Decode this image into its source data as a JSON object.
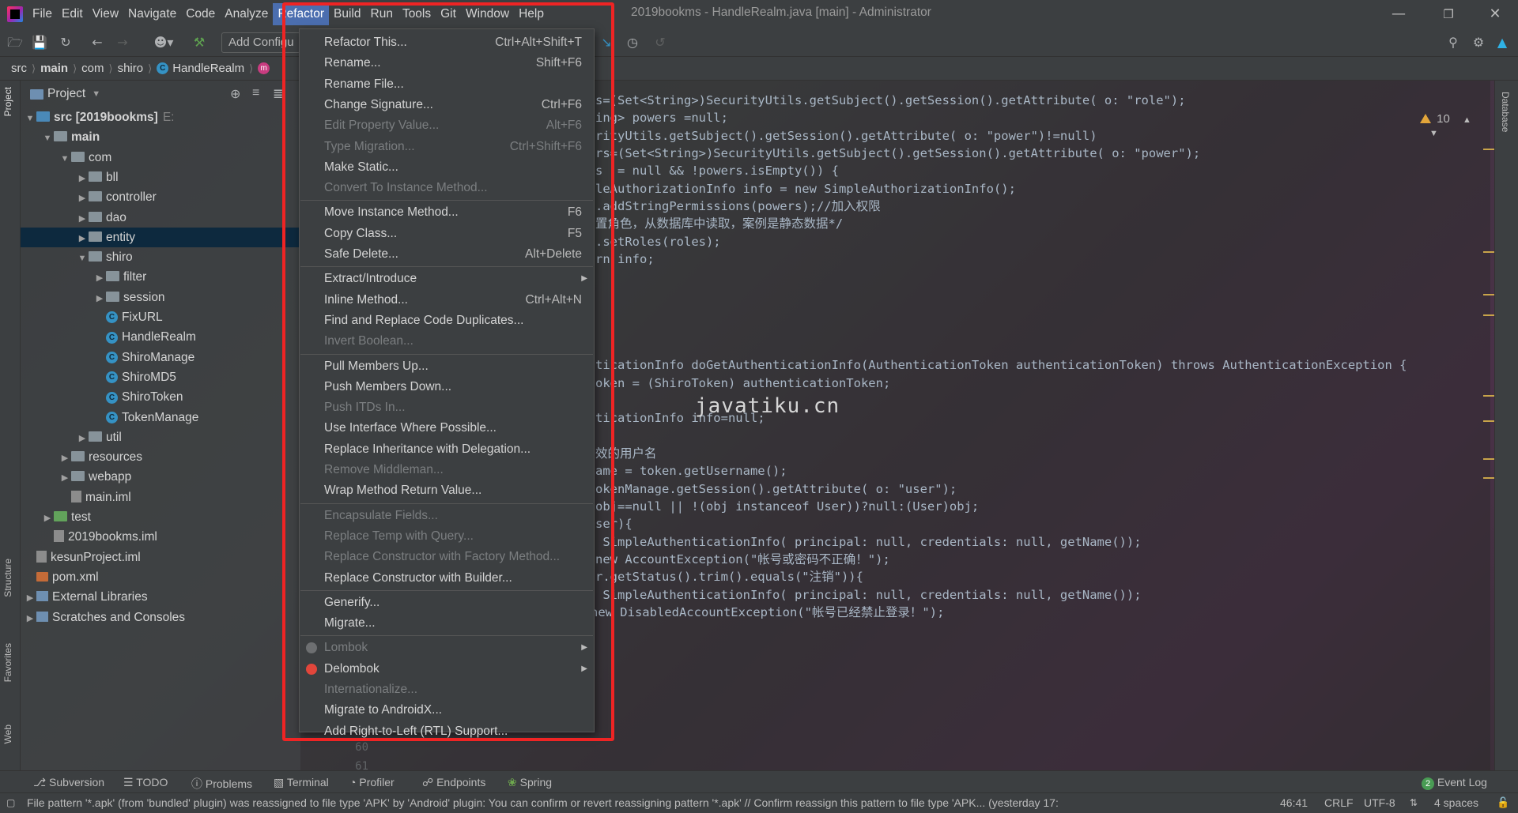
{
  "menubar": {
    "items": [
      "File",
      "Edit",
      "View",
      "Navigate",
      "Code",
      "Analyze",
      "Refactor",
      "Build",
      "Run",
      "Tools",
      "Git",
      "Window",
      "Help"
    ],
    "active": "Refactor"
  },
  "window_title": "2019bookms - HandleRealm.java [main] - Administrator",
  "toolbar": {
    "add_configuration": "Add Configu"
  },
  "breadcrumb": [
    "src",
    "main",
    "com",
    "shiro",
    "HandleRealm"
  ],
  "left_strip": {
    "project": "Project",
    "structure": "Structure",
    "favorites": "Favorites",
    "web": "Web"
  },
  "right_strip": {
    "database": "Database"
  },
  "project": {
    "title": "Project",
    "tree": [
      {
        "label": "src [2019bookms]",
        "suffix": "E:",
        "type": "module"
      },
      {
        "label": "main",
        "type": "folder"
      },
      {
        "label": "com",
        "type": "folder"
      },
      {
        "label": "bll",
        "type": "package"
      },
      {
        "label": "controller",
        "type": "package"
      },
      {
        "label": "dao",
        "type": "package"
      },
      {
        "label": "entity",
        "type": "package"
      },
      {
        "label": "shiro",
        "type": "package"
      },
      {
        "label": "filter",
        "type": "package"
      },
      {
        "label": "session",
        "type": "package"
      },
      {
        "label": "FixURL",
        "type": "class"
      },
      {
        "label": "HandleRealm",
        "type": "class"
      },
      {
        "label": "ShiroManage",
        "type": "class"
      },
      {
        "label": "ShiroMD5",
        "type": "class"
      },
      {
        "label": "ShiroToken",
        "type": "class"
      },
      {
        "label": "TokenManage",
        "type": "class"
      },
      {
        "label": "util",
        "type": "package"
      },
      {
        "label": "resources",
        "type": "resources"
      },
      {
        "label": "webapp",
        "type": "folder"
      },
      {
        "label": "main.iml",
        "type": "file"
      },
      {
        "label": "test",
        "type": "test"
      },
      {
        "label": "2019bookms.iml",
        "type": "file"
      },
      {
        "label": "kesunProject.iml",
        "type": "file"
      },
      {
        "label": "pom.xml",
        "type": "xml"
      },
      {
        "label": "External Libraries",
        "type": "lib"
      },
      {
        "label": "Scratches and Consoles",
        "type": "lib"
      }
    ]
  },
  "editor": {
    "lines": [
      "s=(Set<String>)SecurityUtils.getSubject().getSession().getAttribute( o: \"role\");",
      "ing> powers =null;",
      "rityUtils.getSubject().getSession().getAttribute( o: \"power\")!=null)",
      "rs=(Set<String>)SecurityUtils.getSubject().getSession().getAttribute( o: \"power\");",
      "s  = null && !powers.isEmpty()) {",
      "leAuthorizationInfo info = new SimpleAuthorizationInfo();",
      ".addStringPermissions(powers);//加入权限",
      "置角色，从数据库中读取，案例是静态数据*/",
      ".setRoles(roles);",
      "rn info;",
      "",
      "",
      "",
      "",
      "",
      "ticationInfo doGetAuthenticationInfo(AuthenticationToken authenticationToken) throws AuthenticationException {",
      "oken = (ShiroToken) authenticationToken;",
      "",
      "ticationInfo info=null;",
      "",
      "效的用户名",
      "ame = token.getUsername();",
      "okenManage.getSession().getAttribute( o: \"user\");",
      "obj==null || !(obj instanceof User))?null:(User)obj;",
      "ser){",
      " SimpleAuthenticationInfo( principal: null, credentials: null, getName());",
      "new AccountException(\"帐号或密码不正确！\");",
      "r.getStatus().trim().equals(\"注销\")){",
      " SimpleAuthenticationInfo( principal: null, credentials: null, getName());",
      "    //throw new DisabledAccountException(\"帐号已经禁止登录！\");",
      "}else{"
    ],
    "gutter": [
      "60",
      "61"
    ],
    "watermark": "javatiku.cn",
    "inspection_count": "10"
  },
  "refactor_menu": {
    "items": [
      {
        "label": "Refactor This...",
        "shortcut": "Ctrl+Alt+Shift+T",
        "enabled": true
      },
      {
        "label": "Rename...",
        "shortcut": "Shift+F6",
        "enabled": true
      },
      {
        "label": "Rename File...",
        "shortcut": "",
        "enabled": true
      },
      {
        "label": "Change Signature...",
        "shortcut": "Ctrl+F6",
        "enabled": true
      },
      {
        "label": "Edit Property Value...",
        "shortcut": "Alt+F6",
        "enabled": false
      },
      {
        "label": "Type Migration...",
        "shortcut": "Ctrl+Shift+F6",
        "enabled": false
      },
      {
        "label": "Make Static...",
        "shortcut": "",
        "enabled": true
      },
      {
        "label": "Convert To Instance Method...",
        "shortcut": "",
        "enabled": false
      },
      {
        "separator": true
      },
      {
        "label": "Move Instance Method...",
        "shortcut": "F6",
        "enabled": true
      },
      {
        "label": "Copy Class...",
        "shortcut": "F5",
        "enabled": true
      },
      {
        "label": "Safe Delete...",
        "shortcut": "Alt+Delete",
        "enabled": true
      },
      {
        "separator": true
      },
      {
        "label": "Extract/Introduce",
        "shortcut": "",
        "enabled": true,
        "submenu": true
      },
      {
        "label": "Inline Method...",
        "shortcut": "Ctrl+Alt+N",
        "enabled": true
      },
      {
        "label": "Find and Replace Code Duplicates...",
        "shortcut": "",
        "enabled": true
      },
      {
        "label": "Invert Boolean...",
        "shortcut": "",
        "enabled": false
      },
      {
        "separator": true
      },
      {
        "label": "Pull Members Up...",
        "shortcut": "",
        "enabled": true
      },
      {
        "label": "Push Members Down...",
        "shortcut": "",
        "enabled": true
      },
      {
        "label": "Push ITDs In...",
        "shortcut": "",
        "enabled": false
      },
      {
        "label": "Use Interface Where Possible...",
        "shortcut": "",
        "enabled": true
      },
      {
        "label": "Replace Inheritance with Delegation...",
        "shortcut": "",
        "enabled": true
      },
      {
        "label": "Remove Middleman...",
        "shortcut": "",
        "enabled": false
      },
      {
        "label": "Wrap Method Return Value...",
        "shortcut": "",
        "enabled": true
      },
      {
        "separator": true
      },
      {
        "label": "Encapsulate Fields...",
        "shortcut": "",
        "enabled": false
      },
      {
        "label": "Replace Temp with Query...",
        "shortcut": "",
        "enabled": false
      },
      {
        "label": "Replace Constructor with Factory Method...",
        "shortcut": "",
        "enabled": false
      },
      {
        "label": "Replace Constructor with Builder...",
        "shortcut": "",
        "enabled": true
      },
      {
        "separator": true
      },
      {
        "label": "Generify...",
        "shortcut": "",
        "enabled": true
      },
      {
        "label": "Migrate...",
        "shortcut": "",
        "enabled": true
      },
      {
        "separator": true
      },
      {
        "label": "Lombok",
        "shortcut": "",
        "enabled": false,
        "submenu": true,
        "icon": "lombok-icon"
      },
      {
        "label": "Delombok",
        "shortcut": "",
        "enabled": true,
        "submenu": true,
        "icon": "chili-pepper-icon"
      },
      {
        "label": "Internationalize...",
        "shortcut": "",
        "enabled": false
      },
      {
        "label": "Migrate to AndroidX...",
        "shortcut": "",
        "enabled": true
      },
      {
        "label": "Add Right-to-Left (RTL) Support...",
        "shortcut": "",
        "enabled": true
      }
    ]
  },
  "toolwindows": [
    "Subversion",
    "TODO",
    "Problems",
    "Terminal",
    "Profiler",
    "Endpoints",
    "Spring"
  ],
  "event_log": {
    "label": "Event Log",
    "count": "2"
  },
  "status": {
    "message": "File pattern '*.apk' (from 'bundled' plugin) was reassigned to file type 'APK' by 'Android' plugin: You can confirm or revert reassigning pattern '*.apk' // Confirm reassign this pattern to file type 'APK... (yesterday 17:",
    "position": "46:41",
    "line_sep": "CRLF",
    "encoding": "UTF-8",
    "indent": "4 spaces"
  },
  "colors": {
    "menu_active": "#4b6eaf",
    "highlight_border": "#ef2424",
    "selection": "#0d293e",
    "keyword": "#cc7832",
    "string": "#6a8759",
    "method": "#ffc66d"
  }
}
